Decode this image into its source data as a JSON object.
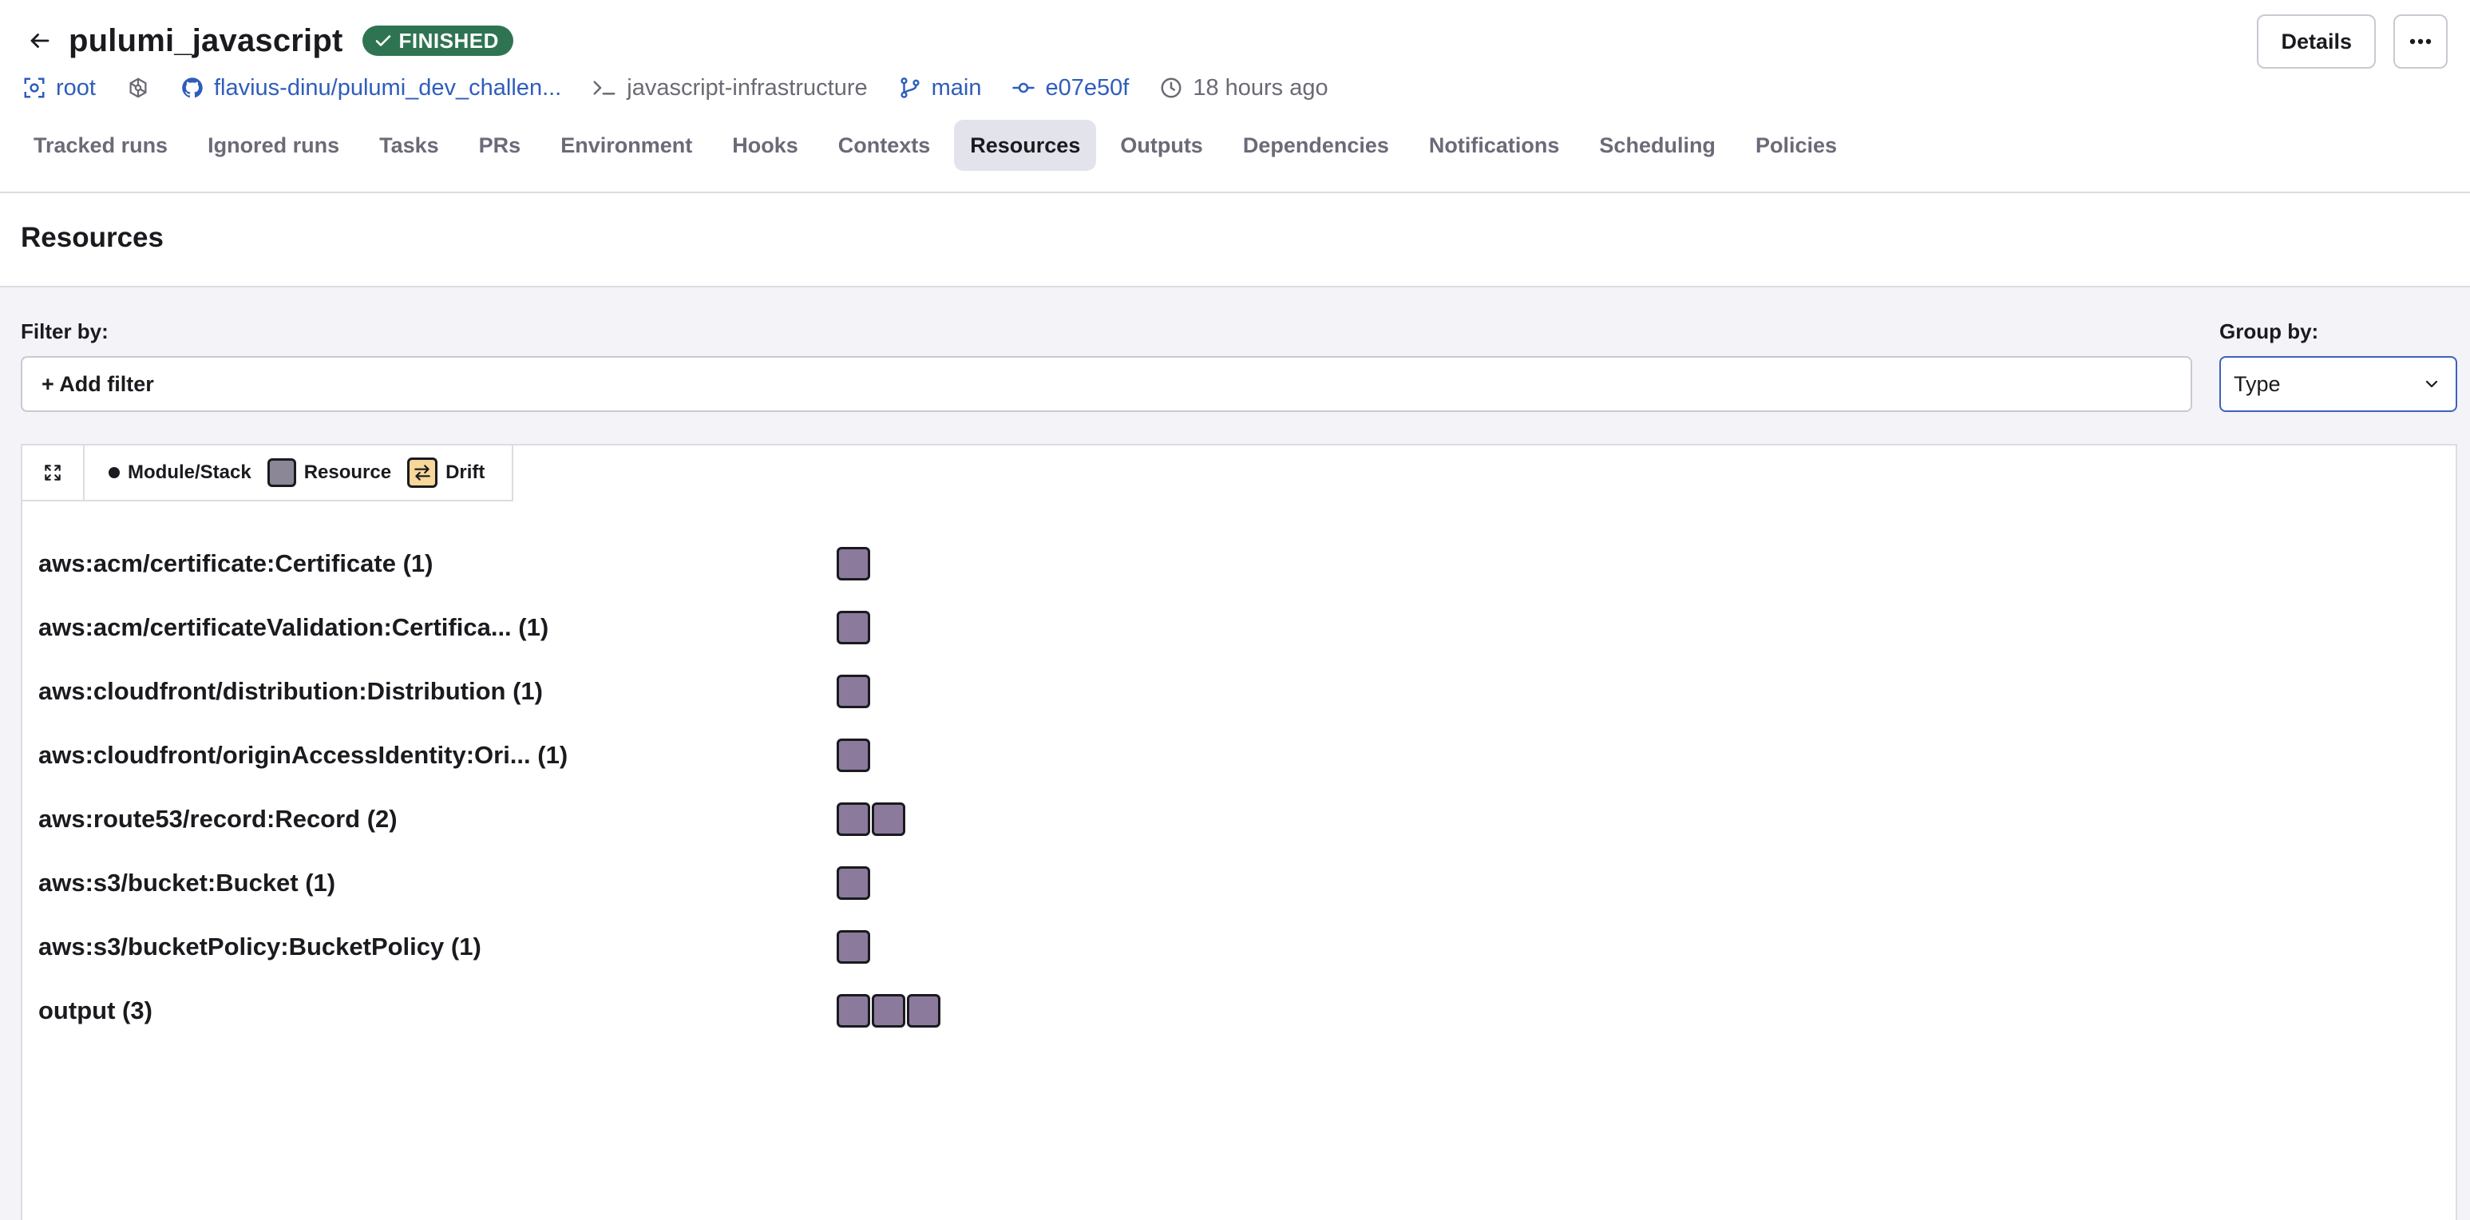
{
  "header": {
    "title": "pulumi_javascript",
    "status": "FINISHED",
    "details_label": "Details",
    "more_label": "⋯"
  },
  "meta": {
    "space": "root",
    "repository": "flavius-dinu/pulumi_dev_challen...",
    "project_root": "javascript-infrastructure",
    "branch": "main",
    "commit": "e07e50f",
    "time": "18 hours ago"
  },
  "tabs": [
    {
      "label": "Tracked runs"
    },
    {
      "label": "Ignored runs"
    },
    {
      "label": "Tasks"
    },
    {
      "label": "PRs"
    },
    {
      "label": "Environment"
    },
    {
      "label": "Hooks"
    },
    {
      "label": "Contexts"
    },
    {
      "label": "Resources",
      "active": true
    },
    {
      "label": "Outputs"
    },
    {
      "label": "Dependencies"
    },
    {
      "label": "Notifications"
    },
    {
      "label": "Scheduling"
    },
    {
      "label": "Policies"
    }
  ],
  "section": {
    "title": "Resources"
  },
  "filter": {
    "label": "Filter by:",
    "add_label": "+ Add filter"
  },
  "group": {
    "label": "Group by:",
    "value": "Type"
  },
  "legend": {
    "module_stack": "Module/Stack",
    "resource": "Resource",
    "drift": "Drift"
  },
  "colors": {
    "accent": "#2f5dbb",
    "status_success": "#2f7452",
    "resource_node": "#8b7a9c",
    "drift": "#f7d79a"
  },
  "groups": [
    {
      "label": "aws:acm/certificate:Certificate (1)",
      "count": 1
    },
    {
      "label": "aws:acm/certificateValidation:Certifica... (1)",
      "count": 1
    },
    {
      "label": "aws:cloudfront/distribution:Distribution (1)",
      "count": 1
    },
    {
      "label": "aws:cloudfront/originAccessIdentity:Ori... (1)",
      "count": 1
    },
    {
      "label": "aws:route53/record:Record (2)",
      "count": 2
    },
    {
      "label": "aws:s3/bucket:Bucket (1)",
      "count": 1
    },
    {
      "label": "aws:s3/bucketPolicy:BucketPolicy (1)",
      "count": 1
    },
    {
      "label": "output (3)",
      "count": 3
    }
  ]
}
